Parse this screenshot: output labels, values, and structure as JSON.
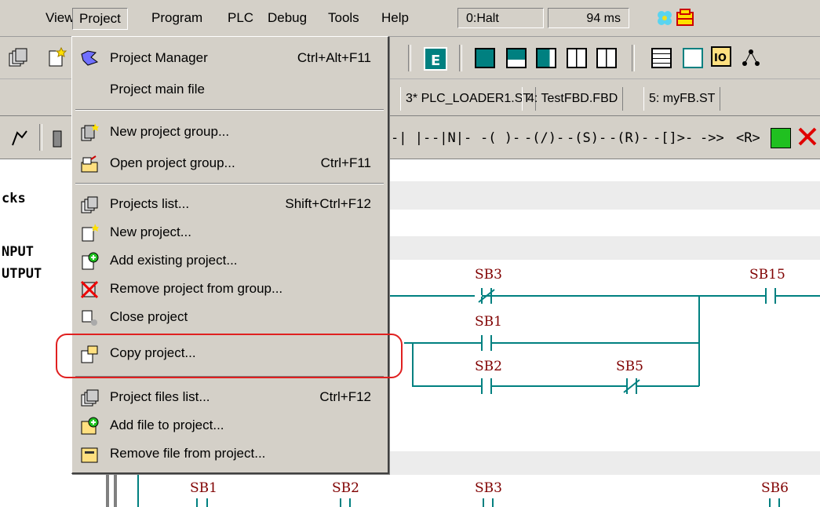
{
  "menubar": {
    "items": [
      "View",
      "Project",
      "Program",
      "PLC",
      "Debug",
      "Tools",
      "Help"
    ],
    "status": "0:Halt",
    "time": "94 ms"
  },
  "tabs": [
    "3* PLC_LOADER1.ST",
    "4: TestFBD.FBD",
    "5: myFB.ST"
  ],
  "ladder_symbols": [
    "-| |-",
    "-|N|-",
    "-( )-",
    "-(/)-",
    "-(S)-",
    "-(R)-",
    "-[]>-",
    "->>",
    "<R>"
  ],
  "left_panel": [
    "cks",
    "NPUT",
    "UTPUT"
  ],
  "menu": {
    "items": [
      {
        "label": "Project Manager",
        "shortcut": "Ctrl+Alt+F11",
        "icon": "project-manager-icon"
      },
      {
        "label": "Project main file",
        "shortcut": "",
        "icon": ""
      },
      {
        "label": "New project group...",
        "shortcut": "",
        "icon": "new-group-icon"
      },
      {
        "label": "Open project group...",
        "shortcut": "Ctrl+F11",
        "icon": "open-group-icon"
      },
      {
        "label": "Projects list...",
        "shortcut": "Shift+Ctrl+F12",
        "icon": "projects-list-icon"
      },
      {
        "label": "New project...",
        "shortcut": "",
        "icon": "new-project-icon"
      },
      {
        "label": "Add existing project...",
        "shortcut": "",
        "icon": "add-project-icon"
      },
      {
        "label": "Remove project from group...",
        "shortcut": "",
        "icon": "remove-project-icon"
      },
      {
        "label": "Close project",
        "shortcut": "",
        "icon": "close-project-icon"
      },
      {
        "label": "Copy project...",
        "shortcut": "",
        "icon": "copy-project-icon"
      },
      {
        "label": "Project files list...",
        "shortcut": "Ctrl+F12",
        "icon": "files-list-icon"
      },
      {
        "label": "Add file to project...",
        "shortcut": "",
        "icon": "add-file-icon"
      },
      {
        "label": "Remove file from project...",
        "shortcut": "",
        "icon": "remove-file-icon"
      }
    ]
  },
  "ladder": {
    "rung1": [
      "SB3",
      "SB15",
      "SB1",
      "SB2",
      "SB5"
    ],
    "rung2": [
      "SB1",
      "SB2",
      "SB3",
      "SB6"
    ]
  },
  "colors": {
    "accent": "#e02020",
    "wire": "#008080",
    "label": "#800000",
    "menu_bg": "#d4d0c8"
  }
}
